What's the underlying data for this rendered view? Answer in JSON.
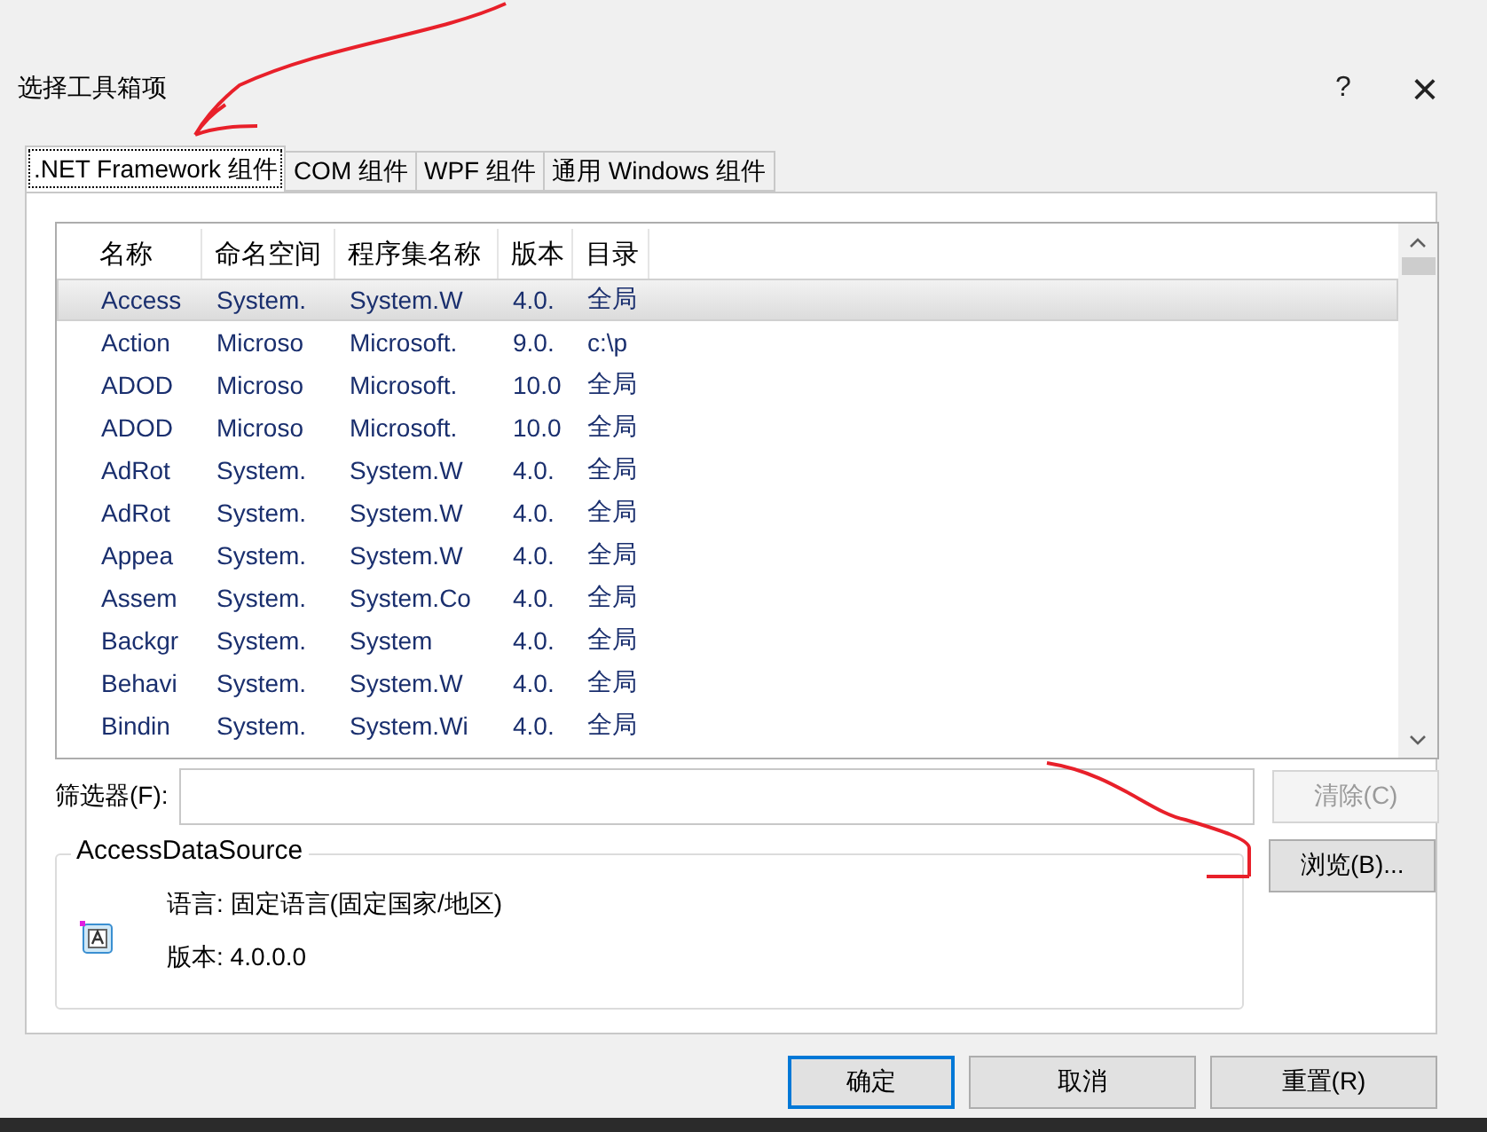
{
  "window": {
    "title": "选择工具箱项",
    "help": "?",
    "close": "×"
  },
  "tabs": [
    {
      "label": ".NET Framework 组件",
      "selected": true
    },
    {
      "label": "COM 组件",
      "selected": false
    },
    {
      "label": "WPF 组件",
      "selected": false
    },
    {
      "label": "通用 Windows 组件",
      "selected": false
    }
  ],
  "table": {
    "columns": [
      "名称",
      "命名空间",
      "程序集名称",
      "版本",
      "目录"
    ],
    "rows": [
      {
        "cells": [
          "Access",
          "System.",
          "System.W",
          "4.0.",
          "全局"
        ],
        "selected": true
      },
      {
        "cells": [
          "Action",
          "Microso",
          "Microsoft.",
          "9.0.",
          "c:\\p"
        ],
        "selected": false
      },
      {
        "cells": [
          "ADOD",
          "Microso",
          "Microsoft.",
          "10.0",
          "全局"
        ],
        "selected": false
      },
      {
        "cells": [
          "ADOD",
          "Microso",
          "Microsoft.",
          "10.0",
          "全局"
        ],
        "selected": false
      },
      {
        "cells": [
          "AdRot",
          "System.",
          "System.W",
          "4.0.",
          "全局"
        ],
        "selected": false
      },
      {
        "cells": [
          "AdRot",
          "System.",
          "System.W",
          "4.0.",
          "全局"
        ],
        "selected": false
      },
      {
        "cells": [
          "Appea",
          "System.",
          "System.W",
          "4.0.",
          "全局"
        ],
        "selected": false
      },
      {
        "cells": [
          "Assem",
          "System.",
          "System.Co",
          "4.0.",
          "全局"
        ],
        "selected": false
      },
      {
        "cells": [
          "Backgr",
          "System.",
          "System",
          "4.0.",
          "全局"
        ],
        "selected": false
      },
      {
        "cells": [
          "Behavi",
          "System.",
          "System.W",
          "4.0.",
          "全局"
        ],
        "selected": false
      },
      {
        "cells": [
          "Bindin",
          "System.",
          "System.Wi",
          "4.0.",
          "全局"
        ],
        "selected": false
      }
    ]
  },
  "filter": {
    "label": "筛选器(F):",
    "clear_button": {
      "label": "清除(C)",
      "disabled": true
    }
  },
  "details": {
    "title": "AccessDataSource",
    "language": "语言: 固定语言(固定国家/地区)",
    "version": "版本: 4.0.0.0"
  },
  "browse_button": "浏览(B)...",
  "buttons": [
    "确定",
    "取消",
    "重置(R)"
  ]
}
